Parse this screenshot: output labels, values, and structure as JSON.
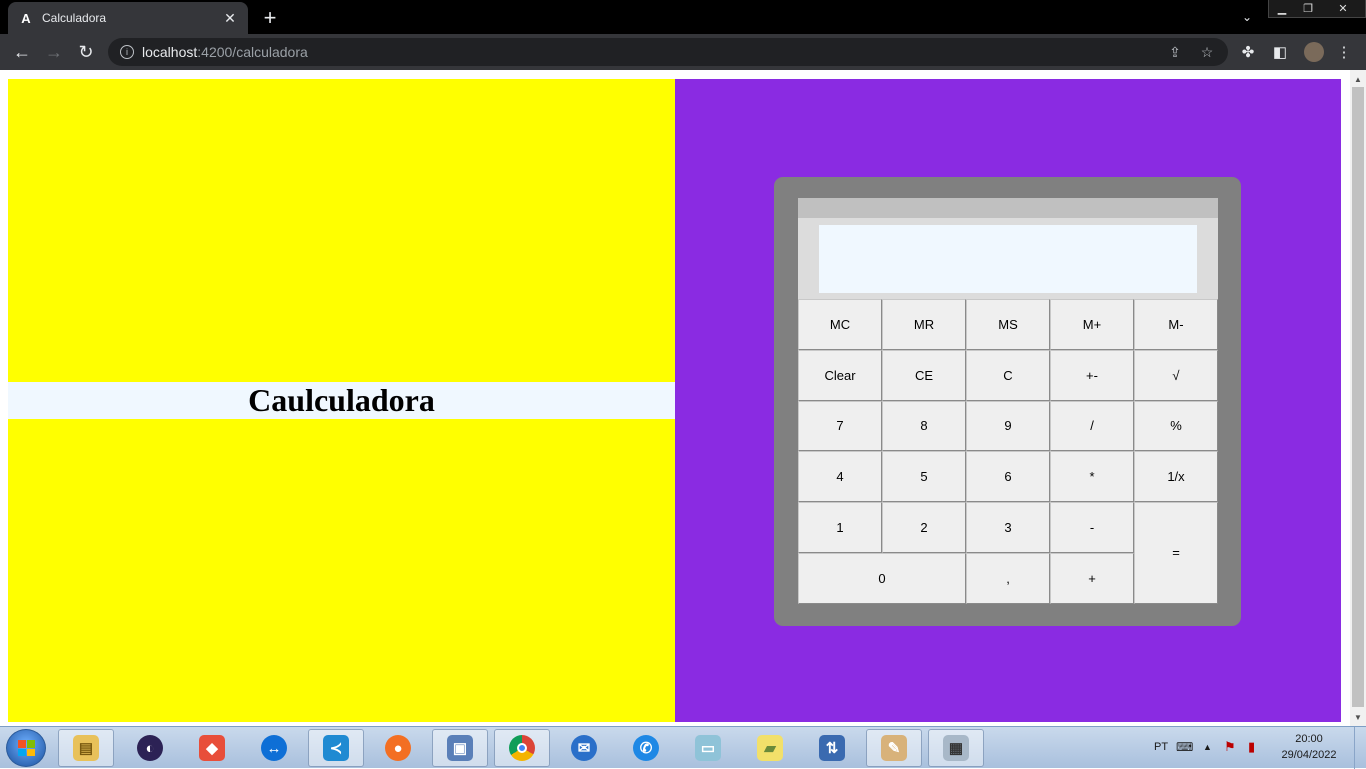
{
  "browser": {
    "tab_title": "Calculadora",
    "tab_favicon": "A",
    "url_host": "localhost",
    "url_path": ":4200/calculadora"
  },
  "page": {
    "heading": "Caulculadora",
    "left_bg": "#ffff00",
    "right_bg": "#8a2be2"
  },
  "calculator": {
    "display": "",
    "keys": [
      "MC",
      "MR",
      "MS",
      "M+",
      "M-",
      "Clear",
      "CE",
      "C",
      "+-",
      "√",
      "7",
      "8",
      "9",
      "/",
      "%",
      "4",
      "5",
      "6",
      "*",
      "1/x",
      "1",
      "2",
      "3",
      "-",
      "=",
      "0",
      ",",
      "+"
    ]
  },
  "taskbar": {
    "language": "PT",
    "time": "20:00",
    "date": "29/04/2022",
    "apps": [
      "file-explorer",
      "eclipse",
      "git",
      "teamviewer",
      "vscode",
      "firefox",
      "remote-desktop",
      "chrome",
      "thunderbird",
      "phone",
      "notepad",
      "sticky-notes",
      "network",
      "paint",
      "calculator"
    ]
  }
}
